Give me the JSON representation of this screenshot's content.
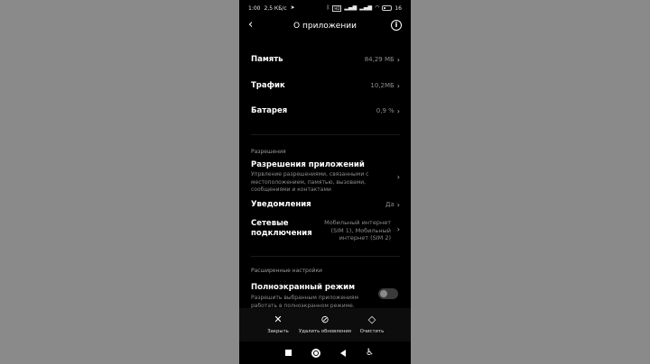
{
  "status_bar": {
    "time": "1:00",
    "speed": "2,5 КБ/с",
    "battery_level": "16"
  },
  "header": {
    "title": "О приложении"
  },
  "rows": [
    {
      "label": "Память",
      "value": "84,29 МБ"
    },
    {
      "label": "Трафик",
      "value": "10,2МБ"
    },
    {
      "label": "Батарея",
      "value": "0,9 %"
    }
  ],
  "permissions_section": {
    "header": "Разрешения",
    "app_permissions": {
      "label": "Разрешения приложений",
      "description": "Упрвление разрешениями, связанными с местоположением, памятью, вызовами, сообщениями и контактами"
    },
    "notifications": {
      "label": "Уведомления",
      "value": "Да"
    },
    "network": {
      "label": "Сетевые подключения",
      "value": "Мобильный интернет (SIM 1), Мобильный интернет (SIM 2)"
    }
  },
  "advanced_section": {
    "header": "Расширенные настройки",
    "fullscreen": {
      "label": "Полноэкранный режим",
      "description": "Разрешить выбранным приложениям работать в полноэкранном режиме."
    }
  },
  "actions": {
    "close": "Закрыть",
    "uninstall_updates": "Удалить обновления",
    "clear": "Очистить"
  },
  "colors": {
    "background": "#000000",
    "secondary_text": "#8c8c8c"
  }
}
